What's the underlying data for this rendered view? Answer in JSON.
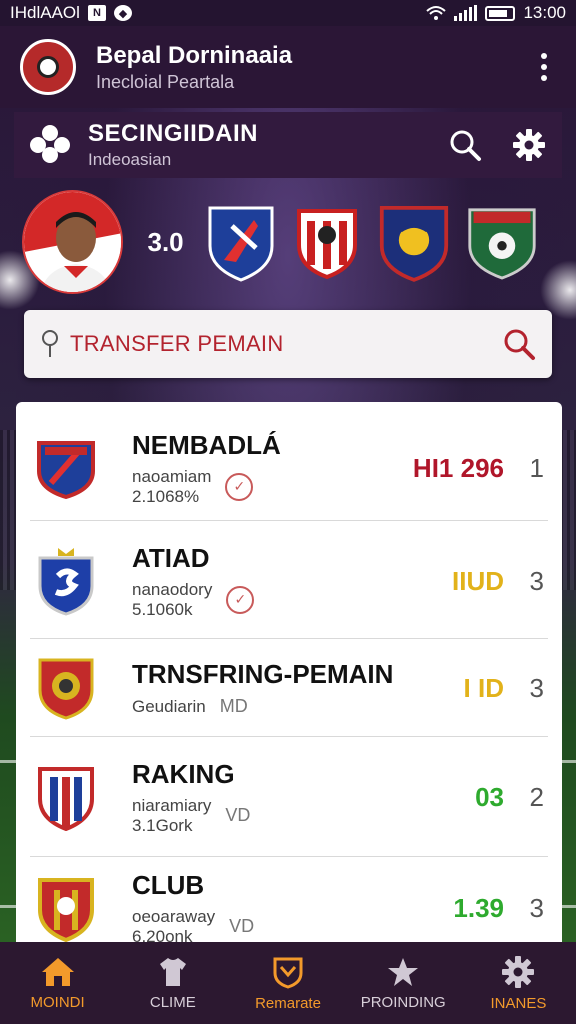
{
  "status_bar": {
    "left_text": "IHdlAAOl",
    "time": "13:00"
  },
  "app_header": {
    "title": "Bepal Dorninaaia",
    "subtitle": "Inecloial Peartala",
    "logo_icon": "club-crest-icon",
    "menu_icon": "kebab-menu-icon"
  },
  "section": {
    "title": "SECINGIIDAIN",
    "subtitle": "Indeoasian",
    "icons": [
      "flower-icon",
      "search-icon",
      "gear-icon"
    ]
  },
  "hero": {
    "score": "3.0",
    "crests": [
      "blue-red-shield",
      "red-white-shield",
      "navy-gold-shield",
      "green-shield"
    ]
  },
  "search": {
    "label": "TRANSFER PEMAIN",
    "icon": "search-icon"
  },
  "list": [
    {
      "name": "NEMBADLÁ",
      "sub1": "naoamiam",
      "sub2": "2.1068%",
      "badge": "check",
      "value": "HI1 296",
      "value_color": "#b0162a",
      "rank": "1",
      "crest": "blue-red"
    },
    {
      "name": "ATIAD",
      "sub1": "nanaodory",
      "sub2": "5.1060k",
      "badge": "check",
      "value": "IIUD",
      "value_color": "#e2b21a",
      "rank": "3",
      "crest": "blue-white"
    },
    {
      "name": "TRNSFRING-PEMAIN",
      "sub1": "Geudiarin",
      "sub2": "",
      "badge": "MD",
      "value": "I ID",
      "value_color": "#e2b21a",
      "rank": "3",
      "crest": "red-gold"
    },
    {
      "name": "RAKING",
      "sub1": "niaramiary",
      "sub2": "3.1Gork",
      "badge": "VD",
      "value": "03",
      "value_color": "#2eaa2e",
      "rank": "2",
      "crest": "red-blue-stripes"
    },
    {
      "name": "CLUB",
      "sub1": "oeoaraway",
      "sub2": "6.20onk",
      "badge": "VD",
      "value": "1.39",
      "value_color": "#2eaa2e",
      "rank": "3",
      "crest": "red-gold-stripes"
    }
  ],
  "bottom_nav": [
    {
      "label": "MOINDI",
      "icon": "home-icon",
      "active": true
    },
    {
      "label": "CLIME",
      "icon": "jersey-icon",
      "active": false
    },
    {
      "label": "Remarate",
      "icon": "shield-icon",
      "active": false
    },
    {
      "label": "PROINDING",
      "icon": "star-icon",
      "active": false
    },
    {
      "label": "INANES",
      "icon": "gear-icon",
      "active": false
    }
  ],
  "colors": {
    "accent": "#f39a2b",
    "header_bg": "#2b1636",
    "search_text": "#b3232e"
  }
}
